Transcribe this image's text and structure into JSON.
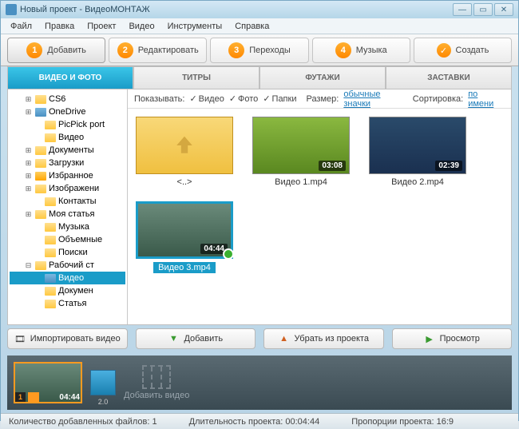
{
  "window": {
    "title": "Новый проект - ВидеоМОНТАЖ"
  },
  "menu": [
    "Файл",
    "Правка",
    "Проект",
    "Видео",
    "Инструменты",
    "Справка"
  ],
  "steps": [
    {
      "num": "1",
      "label": "Добавить"
    },
    {
      "num": "2",
      "label": "Редактировать"
    },
    {
      "num": "3",
      "label": "Переходы"
    },
    {
      "num": "4",
      "label": "Музыка"
    },
    {
      "label": "Создать",
      "check": true
    }
  ],
  "tabs": [
    "ВИДЕО И ФОТО",
    "ТИТРЫ",
    "ФУТАЖИ",
    "ЗАСТАВКИ"
  ],
  "tree": [
    {
      "pad": 18,
      "exp": "⊞",
      "icon": "y",
      "label": "CS6"
    },
    {
      "pad": 18,
      "exp": "⊞",
      "icon": "b",
      "label": "OneDrive"
    },
    {
      "pad": 30,
      "exp": "",
      "icon": "y",
      "label": "PicPick port"
    },
    {
      "pad": 30,
      "exp": "",
      "icon": "y",
      "label": "Видео"
    },
    {
      "pad": 18,
      "exp": "⊞",
      "icon": "y",
      "label": "Документы"
    },
    {
      "pad": 18,
      "exp": "⊞",
      "icon": "y",
      "label": "Загрузки"
    },
    {
      "pad": 18,
      "exp": "⊞",
      "icon": "s",
      "label": "Избранное"
    },
    {
      "pad": 18,
      "exp": "⊞",
      "icon": "y",
      "label": "Изображени"
    },
    {
      "pad": 30,
      "exp": "",
      "icon": "y",
      "label": "Контакты"
    },
    {
      "pad": 18,
      "exp": "⊞",
      "icon": "y",
      "label": "Моя статья"
    },
    {
      "pad": 30,
      "exp": "",
      "icon": "y",
      "label": "Музыка"
    },
    {
      "pad": 30,
      "exp": "",
      "icon": "y",
      "label": "Объемные"
    },
    {
      "pad": 30,
      "exp": "",
      "icon": "y",
      "label": "Поиски"
    },
    {
      "pad": 18,
      "exp": "⊟",
      "icon": "y",
      "label": "Рабочий ст"
    },
    {
      "pad": 30,
      "exp": "",
      "icon": "b",
      "label": "Видео",
      "selected": true
    },
    {
      "pad": 30,
      "exp": "",
      "icon": "y",
      "label": "Докумен"
    },
    {
      "pad": 30,
      "exp": "",
      "icon": "y",
      "label": "Статья"
    }
  ],
  "filter": {
    "show": "Показывать:",
    "opts": [
      "Видео",
      "Фото",
      "Папки"
    ],
    "size_label": "Размер:",
    "size_link": "обычные значки",
    "sort_label": "Сортировка:",
    "sort_link": "по имени"
  },
  "thumbs": [
    {
      "type": "up",
      "label": "<..>"
    },
    {
      "type": "v1",
      "label": "Видео 1.mp4",
      "dur": "03:08"
    },
    {
      "type": "v2",
      "label": "Видео 2.mp4",
      "dur": "02:39"
    },
    {
      "type": "v3",
      "label": "Видео 3.mp4",
      "dur": "04:44",
      "selected": true,
      "ok": true
    }
  ],
  "actions": {
    "import": "Импортировать видео",
    "add": "Добавить",
    "remove": "Убрать из проекта",
    "preview": "Просмотр"
  },
  "timeline": {
    "clip_num": "1",
    "clip_dur": "04:44",
    "trans_dur": "2.0",
    "add_label": "Добавить видео"
  },
  "status": {
    "files_label": "Количество добавленных файлов:",
    "files": "1",
    "dur_label": "Длительность проекта:",
    "dur": "00:04:44",
    "ratio_label": "Пропорции проекта:",
    "ratio": "16:9"
  }
}
